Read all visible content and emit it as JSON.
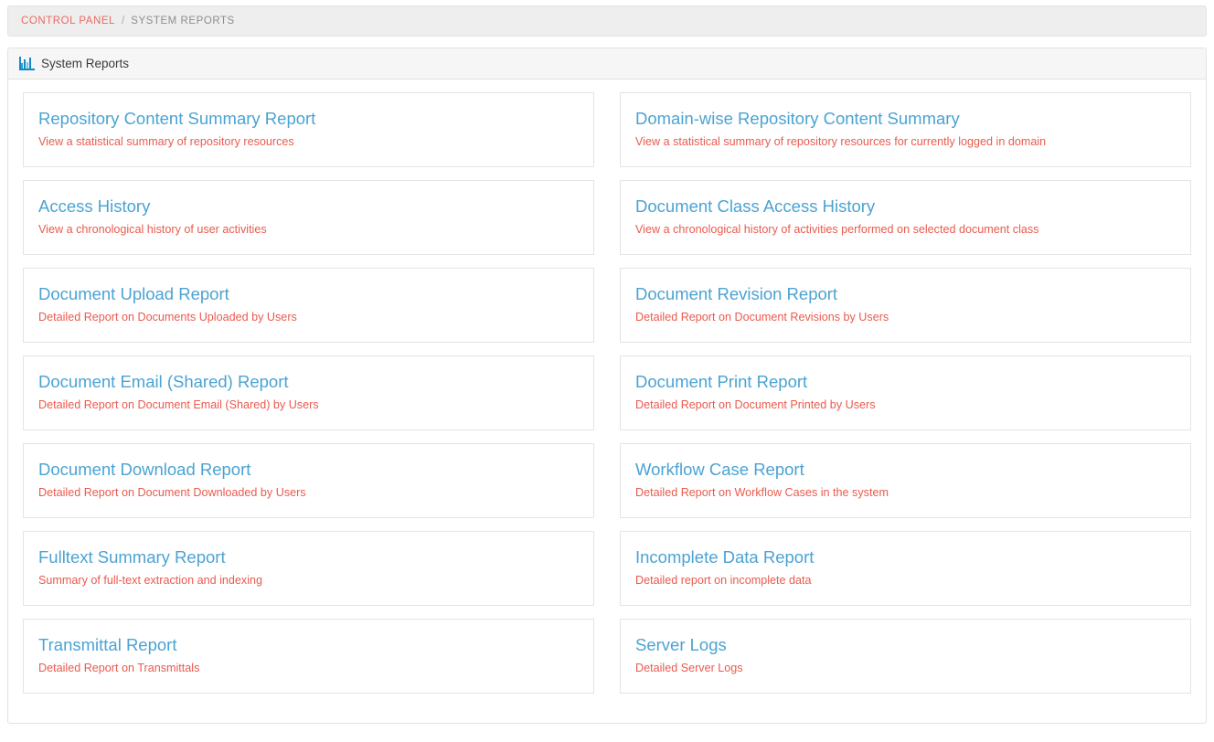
{
  "breadcrumb": {
    "parent": "CONTROL PANEL",
    "separator": "/",
    "current": "SYSTEM REPORTS"
  },
  "panel": {
    "icon": "bar-chart-icon",
    "title": "System Reports"
  },
  "colors": {
    "card_title": "#4ba3d3",
    "card_desc": "#ea5a4e",
    "breadcrumb_link": "#eb6a61",
    "breadcrumb_current": "#8d8d8d",
    "panel_header_bg": "#f6f6f6",
    "breadcrumb_bg": "#eeeeee",
    "border": "#e4e4e4",
    "icon_accent": "#1787c4"
  },
  "reports": {
    "left_column": [
      {
        "title": "Repository Content Summary Report",
        "description": "View a statistical summary of repository resources"
      },
      {
        "title": "Access History",
        "description": "View a chronological history of user activities"
      },
      {
        "title": "Document Upload Report",
        "description": "Detailed Report on Documents Uploaded by Users"
      },
      {
        "title": "Document Email (Shared) Report",
        "description": "Detailed Report on Document Email (Shared) by Users"
      },
      {
        "title": "Document Download Report",
        "description": "Detailed Report on Document Downloaded by Users"
      },
      {
        "title": "Fulltext Summary Report",
        "description": "Summary of full-text extraction and indexing"
      },
      {
        "title": "Transmittal Report",
        "description": "Detailed Report on Transmittals"
      }
    ],
    "right_column": [
      {
        "title": "Domain-wise Repository Content Summary",
        "description": "View a statistical summary of repository resources for currently logged in domain"
      },
      {
        "title": "Document Class Access History",
        "description": "View a chronological history of activities performed on selected document class"
      },
      {
        "title": "Document Revision Report",
        "description": "Detailed Report on Document Revisions by Users"
      },
      {
        "title": "Document Print Report",
        "description": "Detailed Report on Document Printed by Users"
      },
      {
        "title": "Workflow Case Report",
        "description": "Detailed Report on Workflow Cases in the system"
      },
      {
        "title": "Incomplete Data Report",
        "description": "Detailed report on incomplete data"
      },
      {
        "title": "Server Logs",
        "description": "Detailed Server Logs"
      }
    ]
  }
}
